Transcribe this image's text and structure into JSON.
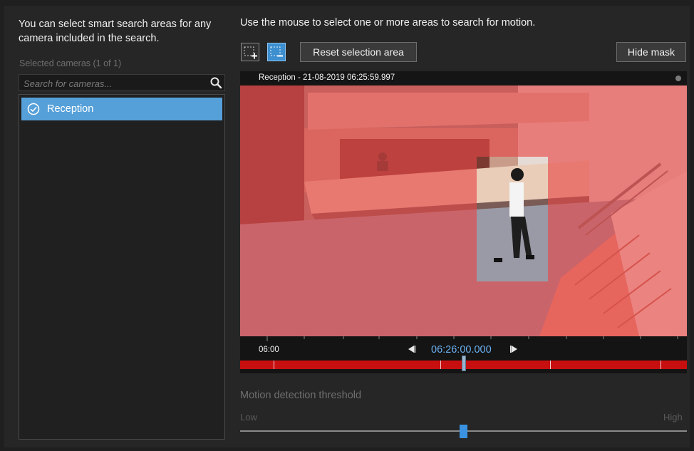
{
  "left_panel": {
    "intro_text": "You can select smart search areas for any camera included in the search.",
    "selected_label": "Selected cameras (1 of 1)",
    "search_placeholder": "Search for cameras...",
    "cameras": [
      {
        "label": "Reception",
        "selected": true
      }
    ]
  },
  "right_panel": {
    "instructions": "Use the mouse to select one or more areas to search for motion.",
    "toolbar": {
      "add_area_icon": "add-selection-icon",
      "remove_area_icon": "remove-selection-icon",
      "reset_label": "Reset selection area",
      "hide_mask_label": "Hide mask"
    },
    "video": {
      "title": "Reception - 21-08-2019 06:25:59.997",
      "mask_color": "#e64646"
    },
    "timeline": {
      "left_time": "06:00",
      "current_time": "06:26:00.000",
      "motion_color": "#c80f0f"
    },
    "threshold": {
      "title": "Motion detection threshold",
      "low_label": "Low",
      "high_label": "High",
      "value": 0.5
    }
  },
  "colors": {
    "accent": "#56a0d9",
    "background": "#262626"
  }
}
